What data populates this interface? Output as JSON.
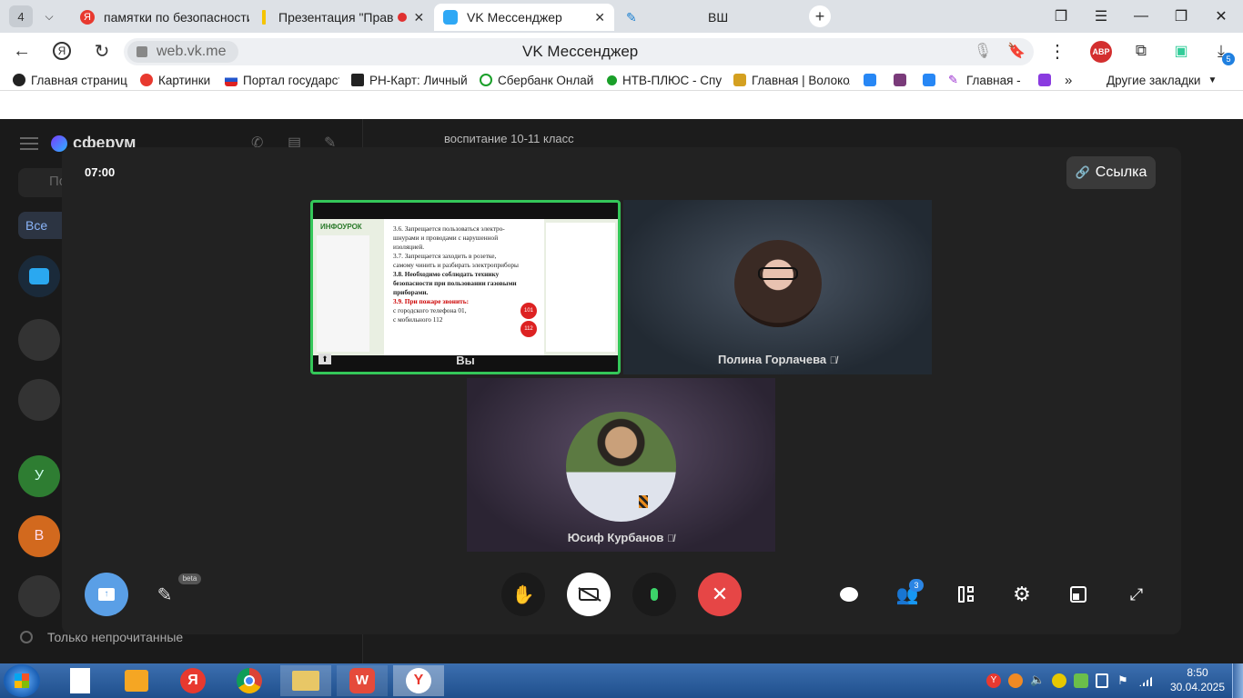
{
  "browser": {
    "tab_count": "4",
    "tabs": [
      {
        "label": "памятки по безопасности"
      },
      {
        "label": "Презентация \"Прав"
      },
      {
        "label": "VK Мессенджер"
      },
      {
        "label": "ВШ"
      }
    ],
    "url_chip": "web.vk.me",
    "url_title": "VK Мессенджер",
    "extension_badge": "ABP",
    "download_badge": "5"
  },
  "bookmarks": {
    "items": [
      {
        "label": "Главная страница"
      },
      {
        "label": "Картинки"
      },
      {
        "label": "Портал государст"
      },
      {
        "label": "РН-Карт: Личный"
      },
      {
        "label": "Сбербанк Онлайн"
      },
      {
        "label": "НТВ-ПЛЮС - Спут"
      },
      {
        "label": "Главная | Волокол"
      },
      {
        "label": "Главная - Е"
      }
    ],
    "other": "Другие закладки"
  },
  "background_app": {
    "logo": "сферум",
    "search_placeholder": "По",
    "filter_all": "Все",
    "chat_title": "воспитание 10-11 класс",
    "avatar_u": "У",
    "avatar_v": "В",
    "unread_only": "Только непрочитанные"
  },
  "call": {
    "timer": "07:00",
    "link_label": "Ссылка",
    "participants": [
      {
        "name": "Вы"
      },
      {
        "name": "Полина Горлачева"
      },
      {
        "name": "Юсиф Курбанов"
      }
    ],
    "beta_label": "beta",
    "people_count": "3",
    "colors": {
      "active_border": "#34c759",
      "hangup": "#e64646",
      "screen_share": "#5a9fe6"
    }
  },
  "slide": {
    "brand": "ИНФОУРОК",
    "lines": [
      "3.6. Запрещается пользоваться электро-",
      "шнурами и проводами с нарушенной",
      "изоляцией.",
      "3.7. Запрещается заходить в розетке,",
      "самому чинить и разбирать электроприборы",
      "3.8. Необходимо соблюдать технику",
      "безопасности при пользовании газовыми",
      "приборами.",
      "3.9. При пожаре звонить:",
      "с городского телефона 01,",
      "с мобильного 112"
    ],
    "badge_1": "101",
    "badge_2": "112"
  },
  "taskbar": {
    "time": "8:50",
    "date": "30.04.2025"
  }
}
